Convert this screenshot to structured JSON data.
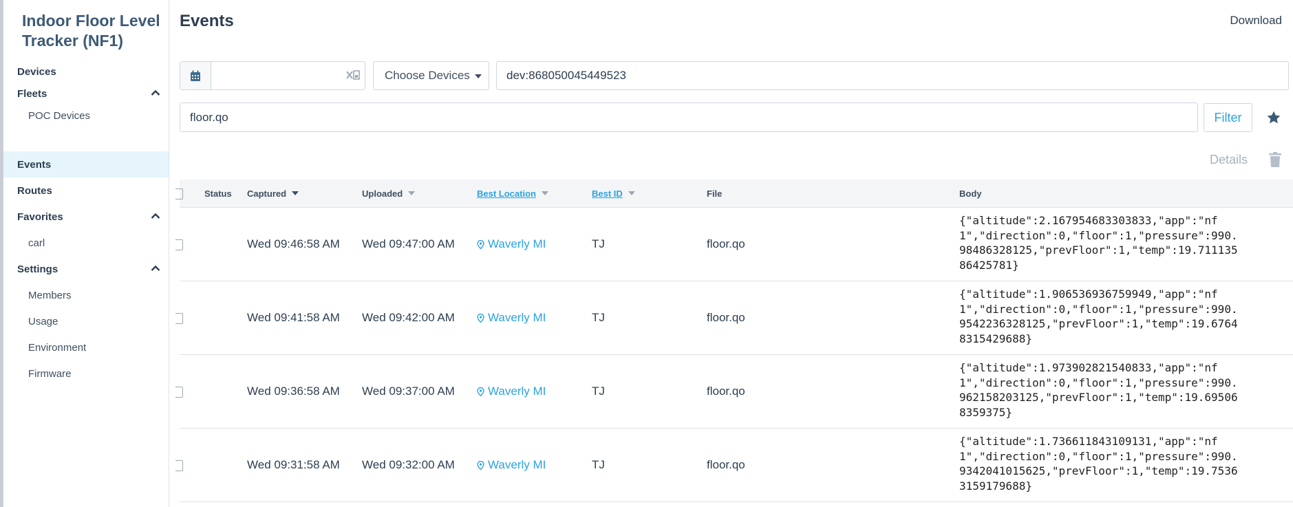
{
  "sidebar": {
    "app_title": "Indoor Floor Level Tracker (NF1)",
    "items": [
      {
        "label": "Devices"
      },
      {
        "label": "Fleets"
      },
      {
        "label": "POC Devices"
      },
      {
        "label": "Events"
      },
      {
        "label": "Routes"
      },
      {
        "label": "Favorites"
      },
      {
        "label": "carl"
      },
      {
        "label": "Settings"
      },
      {
        "label": "Members"
      },
      {
        "label": "Usage"
      },
      {
        "label": "Environment"
      },
      {
        "label": "Firmware"
      }
    ]
  },
  "header": {
    "title": "Events",
    "download_label": "Download"
  },
  "filters": {
    "date_value": "",
    "device_select_label": "Choose Devices",
    "device_query": "dev:868050045449523",
    "file_query": "floor.qo",
    "filter_button": "Filter"
  },
  "actions": {
    "details_label": "Details"
  },
  "table": {
    "columns": [
      "Status",
      "Captured",
      "Uploaded",
      "Best Location",
      "Best ID",
      "File",
      "Body"
    ],
    "rows": [
      {
        "status": "",
        "captured": "Wed 09:46:58 AM",
        "uploaded": "Wed 09:47:00 AM",
        "location": "Waverly MI",
        "best_id": "TJ",
        "file": "floor.qo",
        "body": "{\"altitude\":2.167954683303833,\"app\":\"nf1\",\"direction\":0,\"floor\":1,\"pressure\":990.98486328125,\"prevFloor\":1,\"temp\":19.71113586425781}"
      },
      {
        "status": "",
        "captured": "Wed 09:41:58 AM",
        "uploaded": "Wed 09:42:00 AM",
        "location": "Waverly MI",
        "best_id": "TJ",
        "file": "floor.qo",
        "body": "{\"altitude\":1.906536936759949,\"app\":\"nf1\",\"direction\":0,\"floor\":1,\"pressure\":990.9542236328125,\"prevFloor\":1,\"temp\":19.67648315429688}"
      },
      {
        "status": "",
        "captured": "Wed 09:36:58 AM",
        "uploaded": "Wed 09:37:00 AM",
        "location": "Waverly MI",
        "best_id": "TJ",
        "file": "floor.qo",
        "body": "{\"altitude\":1.973902821540833,\"app\":\"nf1\",\"direction\":0,\"floor\":1,\"pressure\":990.962158203125,\"prevFloor\":1,\"temp\":19.695068359375}"
      },
      {
        "status": "",
        "captured": "Wed 09:31:58 AM",
        "uploaded": "Wed 09:32:00 AM",
        "location": "Waverly MI",
        "best_id": "TJ",
        "file": "floor.qo",
        "body": "{\"altitude\":1.736611843109131,\"app\":\"nf1\",\"direction\":0,\"floor\":1,\"pressure\":990.9342041015625,\"prevFloor\":1,\"temp\":19.75363159179688}"
      }
    ]
  },
  "colors": {
    "accent": "#2ba3e0",
    "active_bg": "#e6f5fc",
    "heading": "#3d5a75"
  },
  "icons": [
    "calendar-icon",
    "clear-date-icon",
    "chevron-up-icon",
    "star-icon",
    "trash-icon",
    "location-pin-icon",
    "sort-caret-icon"
  ]
}
